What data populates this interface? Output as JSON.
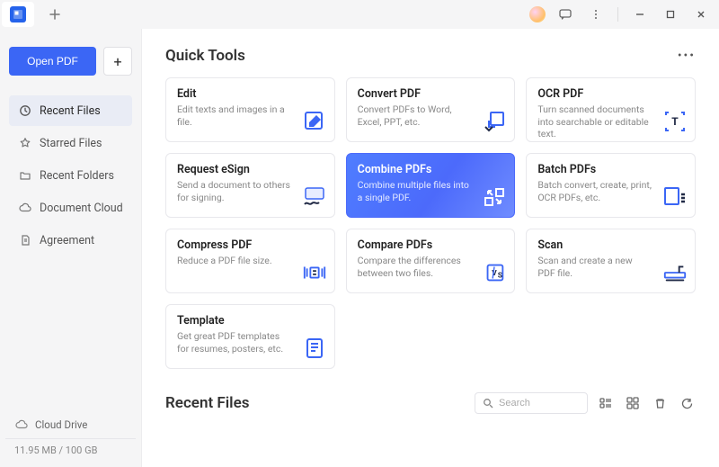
{
  "header": {
    "open_label": "Open PDF"
  },
  "sidebar": {
    "items": [
      {
        "label": "Recent Files"
      },
      {
        "label": "Starred Files"
      },
      {
        "label": "Recent Folders"
      },
      {
        "label": "Document Cloud"
      },
      {
        "label": "Agreement"
      }
    ],
    "cloud_drive_label": "Cloud Drive",
    "storage_text": "11.95 MB / 100 GB"
  },
  "main": {
    "quick_tools_title": "Quick Tools",
    "recent_files_title": "Recent Files",
    "search_placeholder": "Search",
    "tools": [
      {
        "title": "Edit",
        "desc": "Edit texts and images in a file."
      },
      {
        "title": "Convert PDF",
        "desc": "Convert PDFs to Word, Excel, PPT, etc."
      },
      {
        "title": "OCR PDF",
        "desc": "Turn scanned documents into searchable or editable text."
      },
      {
        "title": "Request eSign",
        "desc": "Send a document to others for signing."
      },
      {
        "title": "Combine PDFs",
        "desc": "Combine multiple files into a single PDF."
      },
      {
        "title": "Batch PDFs",
        "desc": "Batch convert, create, print, OCR PDFs, etc."
      },
      {
        "title": "Compress PDF",
        "desc": "Reduce a PDF file size."
      },
      {
        "title": "Compare PDFs",
        "desc": "Compare the differences between two files."
      },
      {
        "title": "Scan",
        "desc": "Scan and create a new PDF file."
      },
      {
        "title": "Template",
        "desc": "Get great PDF templates for resumes, posters, etc."
      }
    ]
  }
}
